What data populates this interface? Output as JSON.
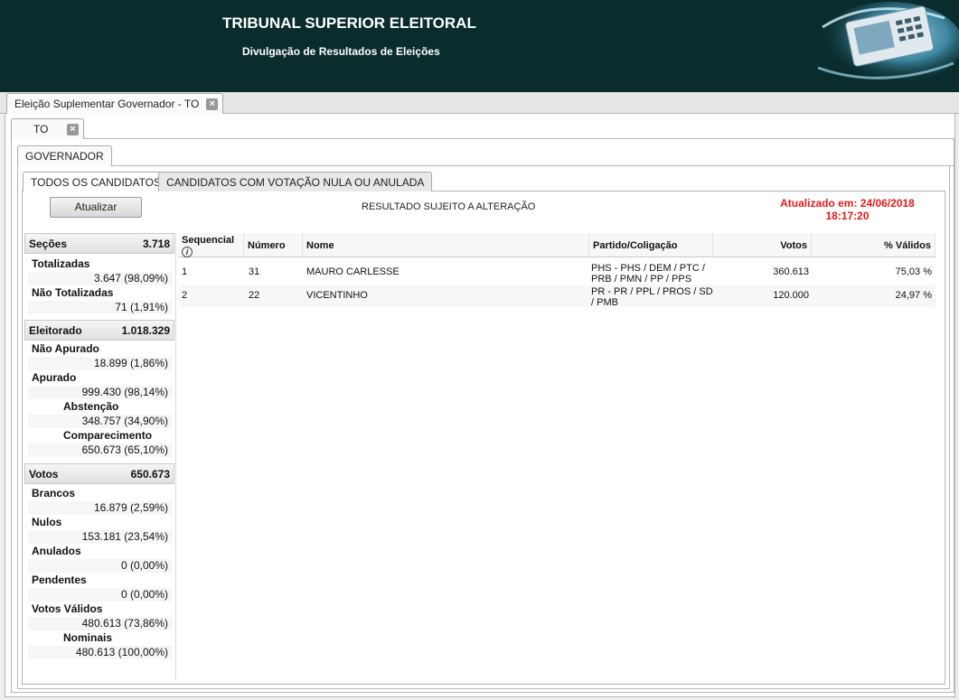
{
  "header": {
    "title": "TRIBUNAL SUPERIOR ELEITORAL",
    "subtitle": "Divulgação de Resultados de Eleições"
  },
  "tabs": {
    "election_tab": "Eleição Suplementar Governador - TO",
    "state_tab": "TO",
    "office_tab": "GOVERNADOR",
    "sub_tabs": [
      "TODOS OS CANDIDATOS",
      "CANDIDATOS COM VOTAÇÃO NULA OU ANULADA"
    ]
  },
  "toolbar": {
    "refresh_label": "Atualizar",
    "notice": "RESULTADO SUJEITO A ALTERAÇÃO",
    "updated_line1": "Atualizado em: 24/06/2018",
    "updated_line2": "18:17:20"
  },
  "summary": {
    "secoes": {
      "label": "Seções",
      "value": "3.718"
    },
    "totalizadas": {
      "label": "Totalizadas",
      "value": "3.647 (98,09%)"
    },
    "nao_totalizadas": {
      "label": "Não Totalizadas",
      "value": "71 (1,91%)"
    },
    "eleitorado": {
      "label": "Eleitorado",
      "value": "1.018.329"
    },
    "nao_apurado": {
      "label": "Não Apurado",
      "value": "18.899 (1,86%)"
    },
    "apurado": {
      "label": "Apurado",
      "value": "999.430 (98,14%)"
    },
    "abstencao": {
      "label": "Abstenção",
      "value": "348.757 (34,90%)"
    },
    "comparecimento": {
      "label": "Comparecimento",
      "value": "650.673 (65,10%)"
    },
    "votos": {
      "label": "Votos",
      "value": "650.673"
    },
    "brancos": {
      "label": "Brancos",
      "value": "16.879 (2,59%)"
    },
    "nulos": {
      "label": "Nulos",
      "value": "153.181 (23,54%)"
    },
    "anulados": {
      "label": "Anulados",
      "value": "0 (0,00%)"
    },
    "pendentes": {
      "label": "Pendentes",
      "value": "0 (0,00%)"
    },
    "votos_validos": {
      "label": "Votos Válidos",
      "value": "480.613 (73,86%)"
    },
    "nominais": {
      "label": "Nominais",
      "value": "480.613 (100,00%)"
    }
  },
  "grid": {
    "columns": [
      "Sequencial",
      "Número",
      "Nome",
      "Partido/Coligação",
      "Votos",
      "% Válidos"
    ],
    "info_icon": "i",
    "rows": [
      {
        "seq": "1",
        "numero": "31",
        "nome": "MAURO CARLESSE",
        "partido": "PHS - PHS / DEM / PTC / PRB / PMN / PP / PPS",
        "votos": "360.613",
        "validos": "75,03 %"
      },
      {
        "seq": "2",
        "numero": "22",
        "nome": "VICENTINHO",
        "partido": "PR - PR / PPL / PROS / SD / PMB",
        "votos": "120.000",
        "validos": "24,97 %"
      }
    ]
  },
  "icons": {
    "close": "close-icon",
    "info": "info-icon"
  },
  "colors": {
    "header_bg": "#0a2c2c",
    "updated_text": "#e8191a"
  }
}
